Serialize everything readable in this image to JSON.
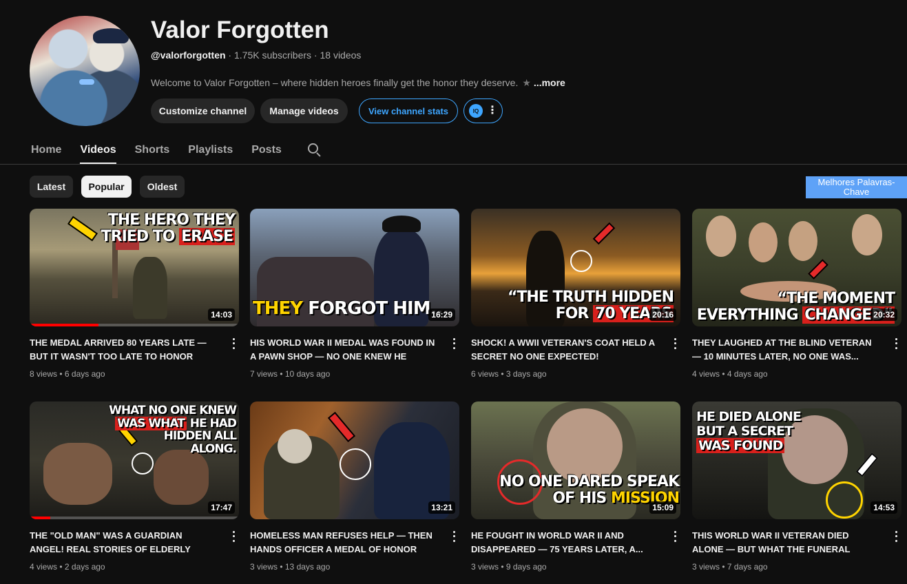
{
  "channel": {
    "title": "Valor Forgotten",
    "handle": "@valorforgotten",
    "stats": " · 1.75K subscribers · 18 videos",
    "description": "Welcome to Valor Forgotten – where hidden heroes finally get the honor they deserve.",
    "more": "...more"
  },
  "actions": {
    "customize": "Customize channel",
    "manage": "Manage videos",
    "stats": "View channel stats",
    "ext_logo": "IQ"
  },
  "tabs": [
    "Home",
    "Videos",
    "Shorts",
    "Playlists",
    "Posts"
  ],
  "active_tab": "Videos",
  "chips": [
    "Latest",
    "Popular",
    "Oldest"
  ],
  "active_chip": "Popular",
  "keyword_button": "Melhores Palavras-Chave",
  "videos": [
    {
      "title": "THE MEDAL ARRIVED 80 YEARS LATE — BUT IT WASN'T TOO LATE TO HONOR HIS...",
      "meta": "8 views • 6 days ago",
      "duration": "14:03",
      "thumb_lines": [
        "THE HERO THEY",
        "TRIED TO ",
        "ERASE"
      ],
      "progress": 0.33
    },
    {
      "title": "HIS WORLD WAR II MEDAL WAS FOUND IN A PAWN SHOP — NO ONE KNEW HE SAVED...",
      "meta": "7 views • 10 days ago",
      "duration": "16:29",
      "thumb_lines": [
        "THEY",
        " FORGOT HIM..."
      ],
      "progress": 0
    },
    {
      "title": "SHOCK! A WWII VETERAN'S COAT HELD A SECRET NO ONE EXPECTED!",
      "meta": "6 views • 3 days ago",
      "duration": "20:16",
      "thumb_lines": [
        "“THE TRUTH HIDDEN",
        "FOR ",
        "70 YEARS"
      ],
      "progress": 0
    },
    {
      "title": "THEY LAUGHED AT THE BLIND VETERAN — 10 MINUTES LATER, NO ONE WAS...",
      "meta": "4 views • 4 days ago",
      "duration": "20:32",
      "thumb_lines": [
        "“THE MOMENT",
        "EVERYTHING ",
        "CHANGED”"
      ],
      "progress": 0
    },
    {
      "title": "THE \"OLD MAN\" WAS A GUARDIAN ANGEL! REAL STORIES OF ELDERLY HEROES",
      "meta": "4 views • 2 days ago",
      "duration": "17:47",
      "thumb_lines": [
        "WHAT NO ONE KNEW",
        "WAS WHAT",
        " HE HAD",
        "HIDDEN ALL",
        "ALONG."
      ],
      "progress": 0.1
    },
    {
      "title": "HOMELESS MAN REFUSES HELP — THEN HANDS OFFICER A MEDAL OF HONOR",
      "meta": "3 views • 13 days ago",
      "duration": "13:21",
      "thumb_lines": [],
      "progress": 0
    },
    {
      "title": "HE FOUGHT IN WORLD WAR II AND DISAPPEARED — 75 YEARS LATER, A...",
      "meta": "3 views • 9 days ago",
      "duration": "15:09",
      "thumb_lines": [
        "NO ONE DARED SPEAK",
        "OF HIS ",
        "MISSION"
      ],
      "progress": 0
    },
    {
      "title": "THIS WORLD WAR II VETERAN DIED ALONE — BUT WHAT THE FUNERAL HOME...",
      "meta": "3 views • 7 days ago",
      "duration": "14:53",
      "thumb_lines": [
        "HE DIED ALONE",
        "BUT A SECRET",
        "WAS FOUND"
      ],
      "progress": 0
    }
  ],
  "colors": {
    "accent": "#3ea6ff",
    "progress": "#ff0000",
    "highlight_yellow": "#ffd400",
    "highlight_red": "#d8201c"
  }
}
